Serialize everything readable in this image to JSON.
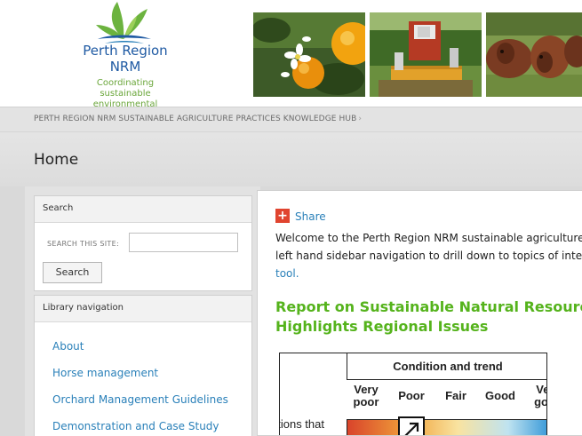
{
  "header": {
    "logo": {
      "title": "Perth Region",
      "subtitle": "NRM",
      "tagline_line1": "Coordinating sustainable",
      "tagline_line2": "environmental outcomes"
    },
    "photos": [
      "oranges-photo",
      "orchard-harvester-photo",
      "cattle-photo"
    ]
  },
  "breadcrumb": {
    "text": "PERTH REGION NRM SUSTAINABLE AGRICULTURE PRACTICES KNOWLEDGE HUB",
    "separator": "›"
  },
  "page": {
    "title": "Home"
  },
  "sidebar": {
    "search": {
      "heading": "Search",
      "label": "SEARCH THIS SITE:",
      "value": "",
      "button_label": "Search"
    },
    "library": {
      "heading": "Library navigation",
      "items": [
        {
          "label": "About"
        },
        {
          "label": "Horse management"
        },
        {
          "label": "Orchard Management Guidelines"
        },
        {
          "label": "Demonstration and Case Study"
        }
      ]
    }
  },
  "main": {
    "share_label": "Share",
    "intro_line1": "Welcome to the Perth Region NRM sustainable agriculture k",
    "intro_line2": "left hand sidebar navigation to drill down to topics of interes",
    "intro_link": "tool.",
    "report_title_line1": "Report on Sustainable Natural Resource U",
    "report_title_line2": "Highlights Regional Issues",
    "figure": {
      "caption": "Condition and trend",
      "columns": [
        "Very poor",
        "Poor",
        "Fair",
        "Good",
        "Very good"
      ],
      "row_label": "ations that"
    }
  },
  "colors": {
    "accent_blue": "#2a80b9",
    "title_green": "#55b31c",
    "share_red": "#e0442f"
  }
}
